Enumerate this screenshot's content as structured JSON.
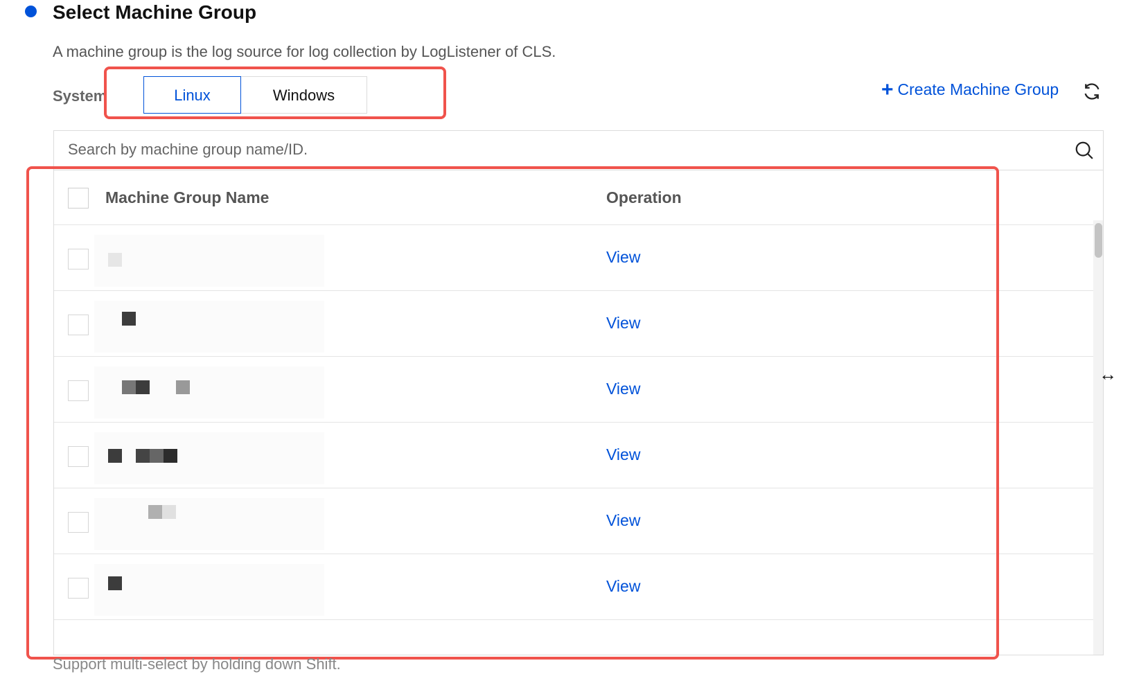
{
  "header": {
    "title": "Select Machine Group",
    "description": "A machine group is the log source for log collection by LogListener of CLS."
  },
  "system": {
    "label": "System",
    "tabs": [
      {
        "label": "Linux",
        "active": true
      },
      {
        "label": "Windows",
        "active": false
      }
    ]
  },
  "toolbar": {
    "create_label": "Create Machine Group",
    "refresh_icon": "refresh-icon"
  },
  "search": {
    "placeholder": "Search by machine group name/ID."
  },
  "table": {
    "columns": [
      "Machine Group Name",
      "Operation"
    ],
    "rows": [
      {
        "name": "",
        "operation": "View"
      },
      {
        "name": "",
        "operation": "View"
      },
      {
        "name": "",
        "operation": "View"
      },
      {
        "name": "",
        "operation": "View"
      },
      {
        "name": "",
        "operation": "View"
      },
      {
        "name": "",
        "operation": "View"
      }
    ]
  },
  "footer": {
    "note": "Support multi-select by holding down Shift."
  },
  "colors": {
    "accent": "#0052d9",
    "highlight": "#f0534c"
  }
}
